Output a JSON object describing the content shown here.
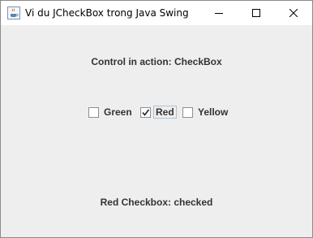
{
  "window": {
    "title": "Vi du JCheckBox trong Java Swing",
    "icon": "java-cup-icon",
    "controls": [
      "minimize-icon",
      "maximize-icon",
      "close-icon"
    ]
  },
  "heading": "Control in action: CheckBox",
  "checkboxes": [
    {
      "label": "Green",
      "checked": false
    },
    {
      "label": "Red",
      "checked": true
    },
    {
      "label": "Yellow",
      "checked": false
    }
  ],
  "status": "Red Checkbox: checked",
  "colors": {
    "content_bg": "#eeeeee",
    "titlebar_bg": "#ffffff",
    "text": "#333333",
    "focus_outline": "#a8c4d9"
  }
}
